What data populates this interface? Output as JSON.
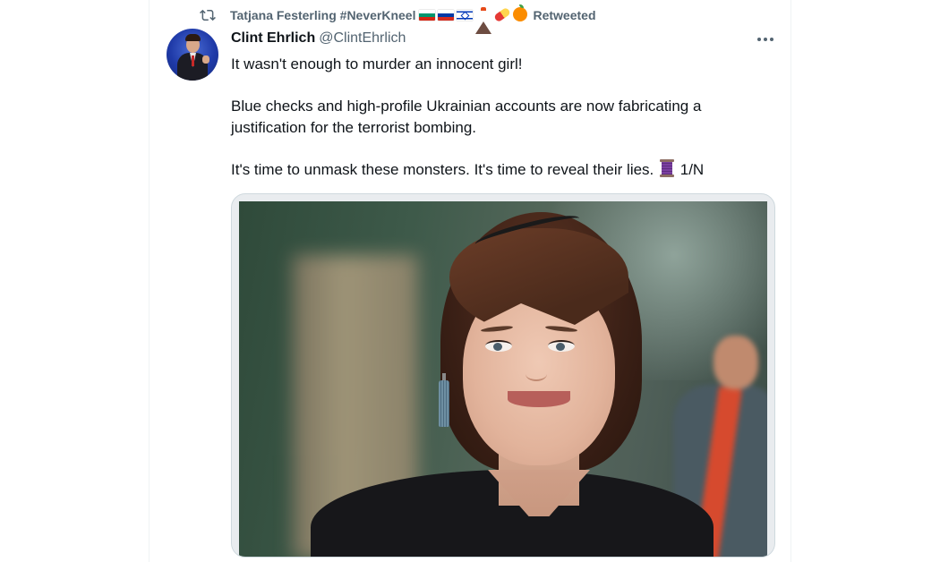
{
  "social_context": {
    "retweeter_name": "Tatjana Festerling #NeverKneel",
    "retweeted_label": "Retweeted",
    "emoji_icons": [
      "flag-bulgaria-icon",
      "flag-russia-icon",
      "flag-israel-icon",
      "volcano-icon",
      "pill-icon",
      "orange-icon"
    ]
  },
  "tweet": {
    "author": {
      "display_name": "Clint Ehrlich",
      "handle": "@ClintEhrlich"
    },
    "text_lines": [
      "It wasn't enough to murder an innocent girl!",
      "Blue checks and high-profile Ukrainian accounts are now fabricating a",
      "justification for the terrorist bombing.",
      "It's time to unmask these monsters. It's time to reveal their lies.",
      "1/N"
    ],
    "thread_emoji": "thread-icon",
    "media": {
      "type": "photo",
      "subject": "portrait-photo"
    }
  },
  "colors": {
    "text_primary": "#0f1419",
    "text_secondary": "#536471",
    "border": "#cfd9de",
    "avatar_background": "#1f3aa8"
  }
}
